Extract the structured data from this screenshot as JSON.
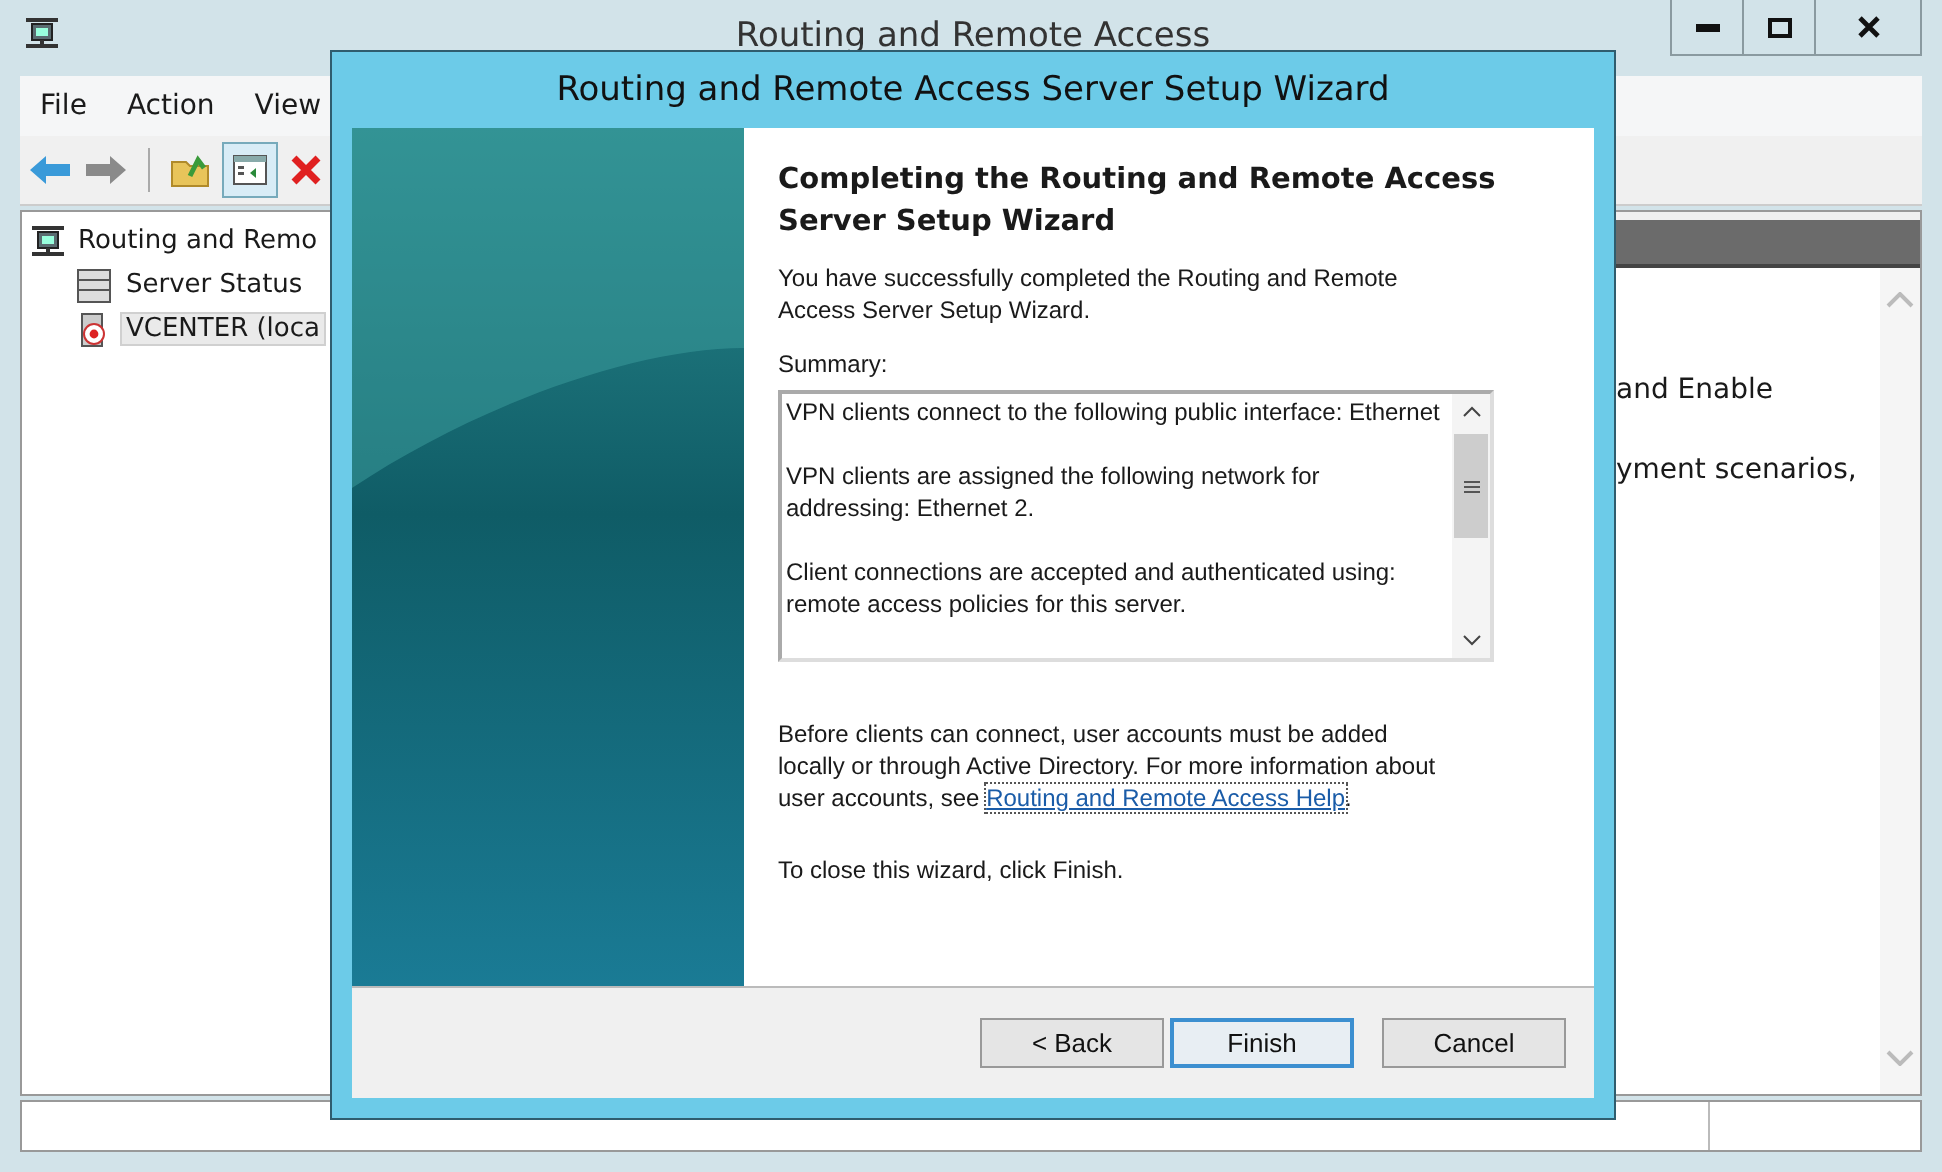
{
  "main_window": {
    "title": "Routing and Remote Access"
  },
  "menu": [
    "File",
    "Action",
    "View"
  ],
  "tree": {
    "label": "Routing and Remo",
    "children": [
      {
        "label": "Server Status",
        "kind": "status",
        "selected": false
      },
      {
        "label": "VCENTER (loca",
        "kind": "server",
        "selected": true
      }
    ]
  },
  "right_pane": {
    "lines": [
      "and Enable",
      "yment scenarios,"
    ]
  },
  "dialog": {
    "title": "Routing and Remote Access Server Setup Wizard",
    "heading": "Completing the Routing and Remote Access Server Setup Wizard",
    "intro": "You have successfully completed the Routing and Remote Access Server Setup Wizard.",
    "summary_label": "Summary:",
    "summary": [
      "VPN clients connect to the following public interface: Ethernet",
      "VPN clients are assigned the following network for addressing: Ethernet 2.",
      "Client connections are accepted and authenticated using: remote access policies for this server."
    ],
    "info_before": "Before clients can connect, user accounts must be added locally or through Active Directory. For more information about user accounts, see ",
    "link": "Routing and Remote Access Help",
    "info_after": ".",
    "closing": "To close this wizard, click Finish.",
    "buttons": [
      {
        "label": "< Back",
        "focused": false
      },
      {
        "label": "Finish",
        "focused": true
      },
      {
        "label": "Cancel",
        "focused": false
      }
    ]
  }
}
